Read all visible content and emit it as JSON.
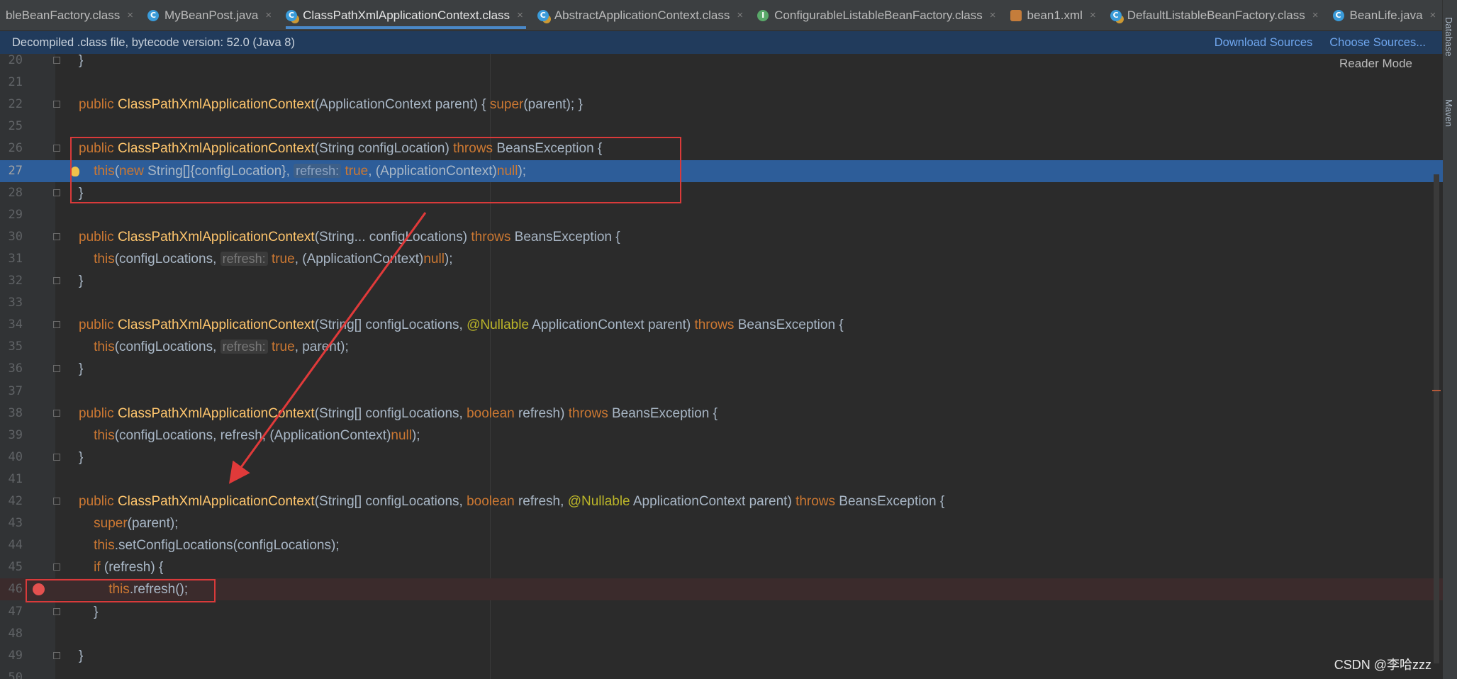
{
  "tabs": [
    {
      "label": "bleBeanFactory.class",
      "icon": "none"
    },
    {
      "label": "MyBeanPost.java",
      "icon": "cls"
    },
    {
      "label": "ClassPathXmlApplicationContext.class",
      "icon": "cls-lock",
      "active": true
    },
    {
      "label": "AbstractApplicationContext.class",
      "icon": "cls-lock"
    },
    {
      "label": "ConfigurableListableBeanFactory.class",
      "icon": "iface"
    },
    {
      "label": "bean1.xml",
      "icon": "xml"
    },
    {
      "label": "DefaultListableBeanFactory.class",
      "icon": "cls-lock"
    },
    {
      "label": "BeanLife.java",
      "icon": "cls"
    }
  ],
  "tab_close_glyph": "×",
  "infobar": {
    "message": "Decompiled .class file, bytecode version: 52.0 (Java 8)",
    "download_sources": "Download Sources",
    "choose_sources": "Choose Sources..."
  },
  "side_tools": {
    "database": "Database",
    "maven": "Maven"
  },
  "editor": {
    "reader_mode": "Reader Mode"
  },
  "watermark": "CSDN @李哈zzz",
  "code_lines": [
    {
      "n": "20",
      "text": "}"
    },
    {
      "n": "21",
      "text": ""
    },
    {
      "n": "22",
      "text": "public ClassPathXmlApplicationContext(ApplicationContext parent) { super(parent); }"
    },
    {
      "n": "25",
      "text": ""
    },
    {
      "n": "26",
      "text": "public ClassPathXmlApplicationContext(String configLocation) throws BeansException {"
    },
    {
      "n": "27",
      "text": "    this(new String[]{configLocation}, refresh: true, (ApplicationContext)null);"
    },
    {
      "n": "28",
      "text": "}"
    },
    {
      "n": "29",
      "text": ""
    },
    {
      "n": "30",
      "text": "public ClassPathXmlApplicationContext(String... configLocations) throws BeansException {"
    },
    {
      "n": "31",
      "text": "    this(configLocations, refresh: true, (ApplicationContext)null);"
    },
    {
      "n": "32",
      "text": "}"
    },
    {
      "n": "33",
      "text": ""
    },
    {
      "n": "34",
      "text": "public ClassPathXmlApplicationContext(String[] configLocations, @Nullable ApplicationContext parent) throws BeansException {"
    },
    {
      "n": "35",
      "text": "    this(configLocations, refresh: true, parent);"
    },
    {
      "n": "36",
      "text": "}"
    },
    {
      "n": "37",
      "text": ""
    },
    {
      "n": "38",
      "text": "public ClassPathXmlApplicationContext(String[] configLocations, boolean refresh) throws BeansException {"
    },
    {
      "n": "39",
      "text": "    this(configLocations, refresh, (ApplicationContext)null);"
    },
    {
      "n": "40",
      "text": "}"
    },
    {
      "n": "41",
      "text": ""
    },
    {
      "n": "42",
      "text": "public ClassPathXmlApplicationContext(String[] configLocations, boolean refresh, @Nullable ApplicationContext parent) throws BeansException {"
    },
    {
      "n": "43",
      "text": "    super(parent);"
    },
    {
      "n": "44",
      "text": "    this.setConfigLocations(configLocations);"
    },
    {
      "n": "45",
      "text": "    if (refresh) {"
    },
    {
      "n": "46",
      "text": "        this.refresh();"
    },
    {
      "n": "47",
      "text": "    }"
    },
    {
      "n": "48",
      "text": ""
    },
    {
      "n": "49",
      "text": "}"
    },
    {
      "n": "50",
      "text": ""
    }
  ],
  "current_line": "27",
  "breakpoint_line": "46",
  "colors": {
    "keyword": "#cc7832",
    "method": "#ffc66d",
    "annotation": "#bbb529",
    "text": "#a9b7c6",
    "selection": "#2d5d99",
    "annotation_box": "#d93a3a"
  }
}
